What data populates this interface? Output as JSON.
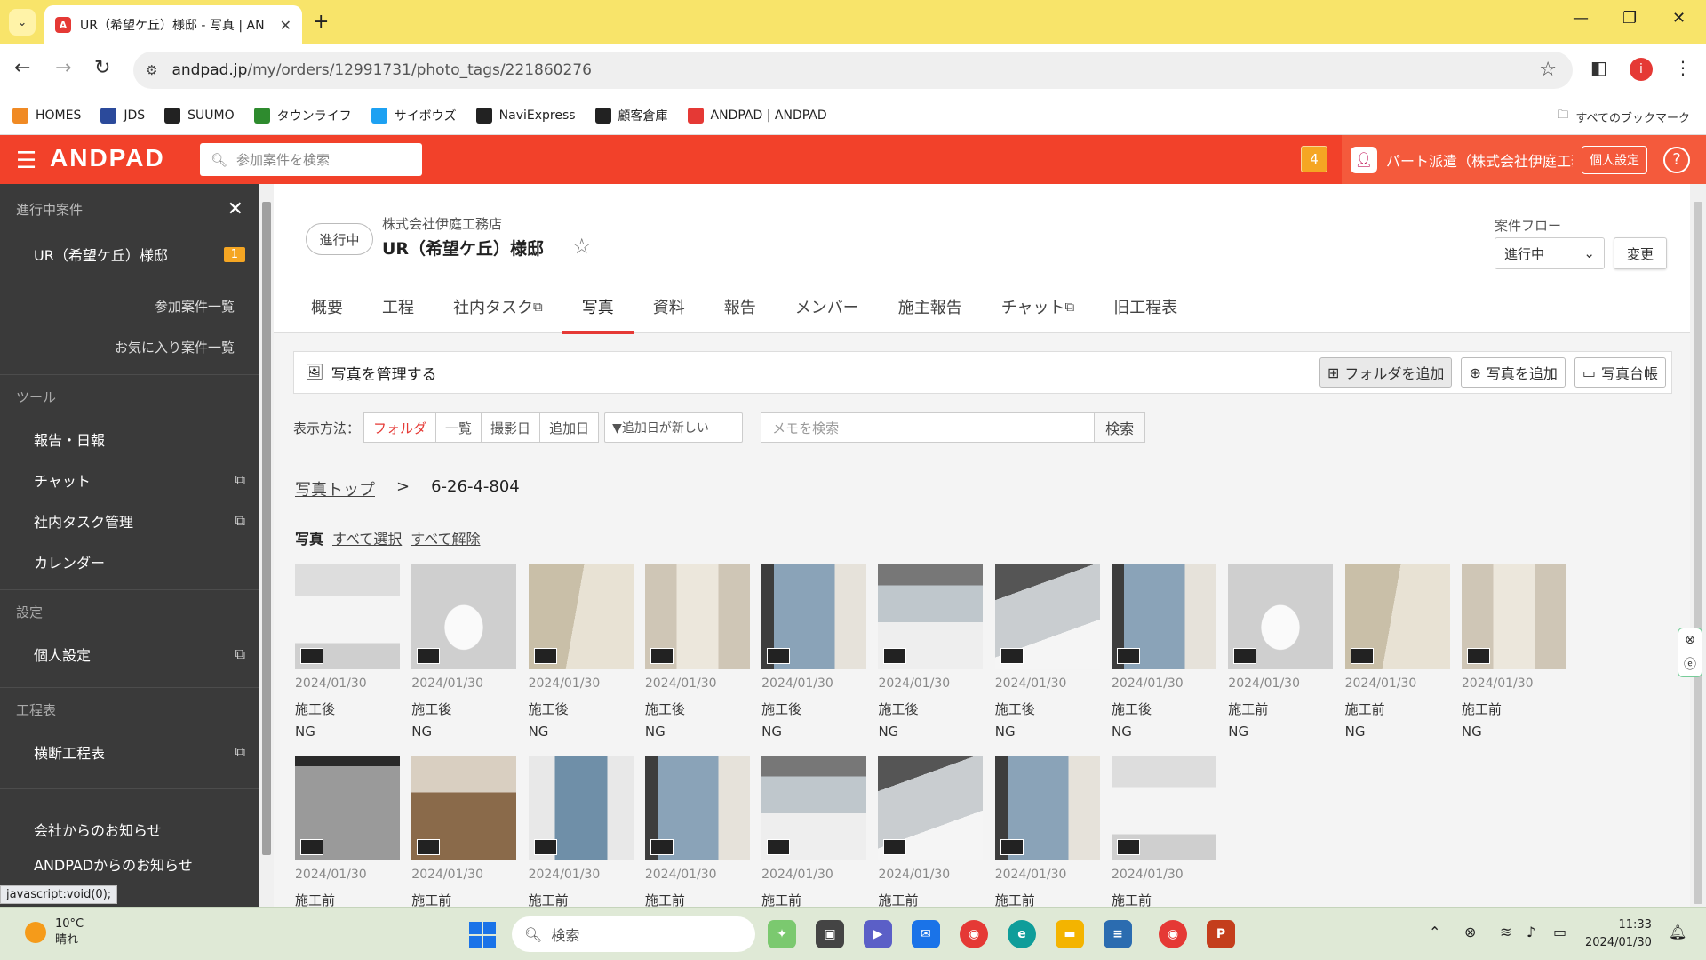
{
  "browser": {
    "tab_title": "UR（希望ケ丘）様邸 - 写真 | AN",
    "favicon": "A",
    "url_domain": "andpad.jp",
    "url_path": "/my/orders/12991731/photo_tags/221860276",
    "profile_initial": "i"
  },
  "bookmarks": [
    {
      "label": "HOMES",
      "color": "#f08a24",
      "icon": "house-icon"
    },
    {
      "label": "JDS",
      "color": "#2b4a9b",
      "icon": "jds-icon"
    },
    {
      "label": "SUUMO",
      "color": "#222222",
      "icon": "globe-icon"
    },
    {
      "label": "タウンライフ",
      "color": "#2e8b2e",
      "icon": "t-icon"
    },
    {
      "label": "サイボウズ",
      "color": "#1da1f2",
      "icon": "c-icon"
    },
    {
      "label": "NaviExpress",
      "color": "#222222",
      "icon": "globe-icon"
    },
    {
      "label": "顧客倉庫",
      "color": "#222222",
      "icon": "globe-icon"
    },
    {
      "label": "ANDPAD | ANDPAD",
      "color": "#e53935",
      "icon": "andpad-icon"
    }
  ],
  "bookmarks_all": "すべてのブックマーク",
  "header": {
    "logo": "ANDPAD",
    "search_placeholder": "参加案件を検索",
    "notification_count": "4",
    "user_name": "パート派遣（株式会社伊庭工務店）",
    "personal_settings": "個人設定"
  },
  "sidebar": {
    "section_active": "進行中案件",
    "active_project": "UR（希望ケ丘）様邸",
    "active_badge": "1",
    "link_participating": "参加案件一覧",
    "link_favorites": "お気に入り案件一覧",
    "section_tools": "ツール",
    "tools": [
      "報告・日報",
      "チャット",
      "社内タスク管理",
      "カレンダー"
    ],
    "section_settings": "設定",
    "settings_item": "個人設定",
    "section_schedule": "工程表",
    "schedule_item": "横断工程表",
    "notice_company": "会社からのお知らせ",
    "notice_andpad": "ANDPADからのお知らせ"
  },
  "project": {
    "status": "進行中",
    "company": "株式会社伊庭工務店",
    "title": "UR（希望ケ丘）様邸",
    "flow_label": "案件フロー",
    "flow_value": "進行中",
    "flow_change": "変更",
    "tabs": [
      "概要",
      "工程",
      "社内タスク",
      "写真",
      "資料",
      "報告",
      "メンバー",
      "施主報告",
      "チャット",
      "旧工程表"
    ],
    "active_tab": "写真"
  },
  "photos": {
    "manage_title": "写真を管理する",
    "btn_add_folder": "フォルダを追加",
    "btn_add_photo": "写真を追加",
    "btn_ledger": "写真台帳",
    "view_label": "表示方法：",
    "view_modes": [
      "フォルダ",
      "一覧",
      "撮影日",
      "追加日"
    ],
    "sort_value": "▼追加日が新しい",
    "memo_placeholder": "メモを検索",
    "search_btn": "検索",
    "breadcrumb_top": "写真トップ",
    "breadcrumb_sep": ">",
    "breadcrumb_current": "6-26-4-804",
    "section_label": "写真",
    "select_all": "すべて選択",
    "deselect_all": "すべて解除",
    "items": [
      {
        "date": "2024/01/30",
        "phase": "施工後",
        "result": "NG",
        "scene": "sink"
      },
      {
        "date": "2024/01/30",
        "phase": "施工後",
        "result": "NG",
        "scene": "toilet"
      },
      {
        "date": "2024/01/30",
        "phase": "施工後",
        "result": "NG",
        "scene": "bath"
      },
      {
        "date": "2024/01/30",
        "phase": "施工後",
        "result": "NG",
        "scene": "door"
      },
      {
        "date": "2024/01/30",
        "phase": "施工後",
        "result": "NG",
        "scene": "window"
      },
      {
        "date": "2024/01/30",
        "phase": "施工後",
        "result": "NG",
        "scene": "kitchen"
      },
      {
        "date": "2024/01/30",
        "phase": "施工後",
        "result": "NG",
        "scene": "counter"
      },
      {
        "date": "2024/01/30",
        "phase": "施工後",
        "result": "NG",
        "scene": "window"
      },
      {
        "date": "2024/01/30",
        "phase": "施工前",
        "result": "NG",
        "scene": "toilet"
      },
      {
        "date": "2024/01/30",
        "phase": "施工前",
        "result": "NG",
        "scene": "bath"
      },
      {
        "date": "2024/01/30",
        "phase": "施工前",
        "result": "NG",
        "scene": "door"
      },
      {
        "date": "2024/01/30",
        "phase": "施工前",
        "result": "",
        "scene": "note"
      },
      {
        "date": "2024/01/30",
        "phase": "施工前",
        "result": "",
        "scene": "floor"
      },
      {
        "date": "2024/01/30",
        "phase": "施工前",
        "result": "",
        "scene": "balcony"
      },
      {
        "date": "2024/01/30",
        "phase": "施工前",
        "result": "",
        "scene": "window"
      },
      {
        "date": "2024/01/30",
        "phase": "施工前",
        "result": "",
        "scene": "kitchen"
      },
      {
        "date": "2024/01/30",
        "phase": "施工前",
        "result": "",
        "scene": "counter"
      },
      {
        "date": "2024/01/30",
        "phase": "施工前",
        "result": "",
        "scene": "window"
      },
      {
        "date": "2024/01/30",
        "phase": "施工前",
        "result": "",
        "scene": "sink"
      }
    ]
  },
  "status_url": "javascript:void(0);",
  "taskbar": {
    "temp": "10°C",
    "weather": "晴れ",
    "search": "検索",
    "time": "11:33",
    "date": "2024/01/30"
  }
}
